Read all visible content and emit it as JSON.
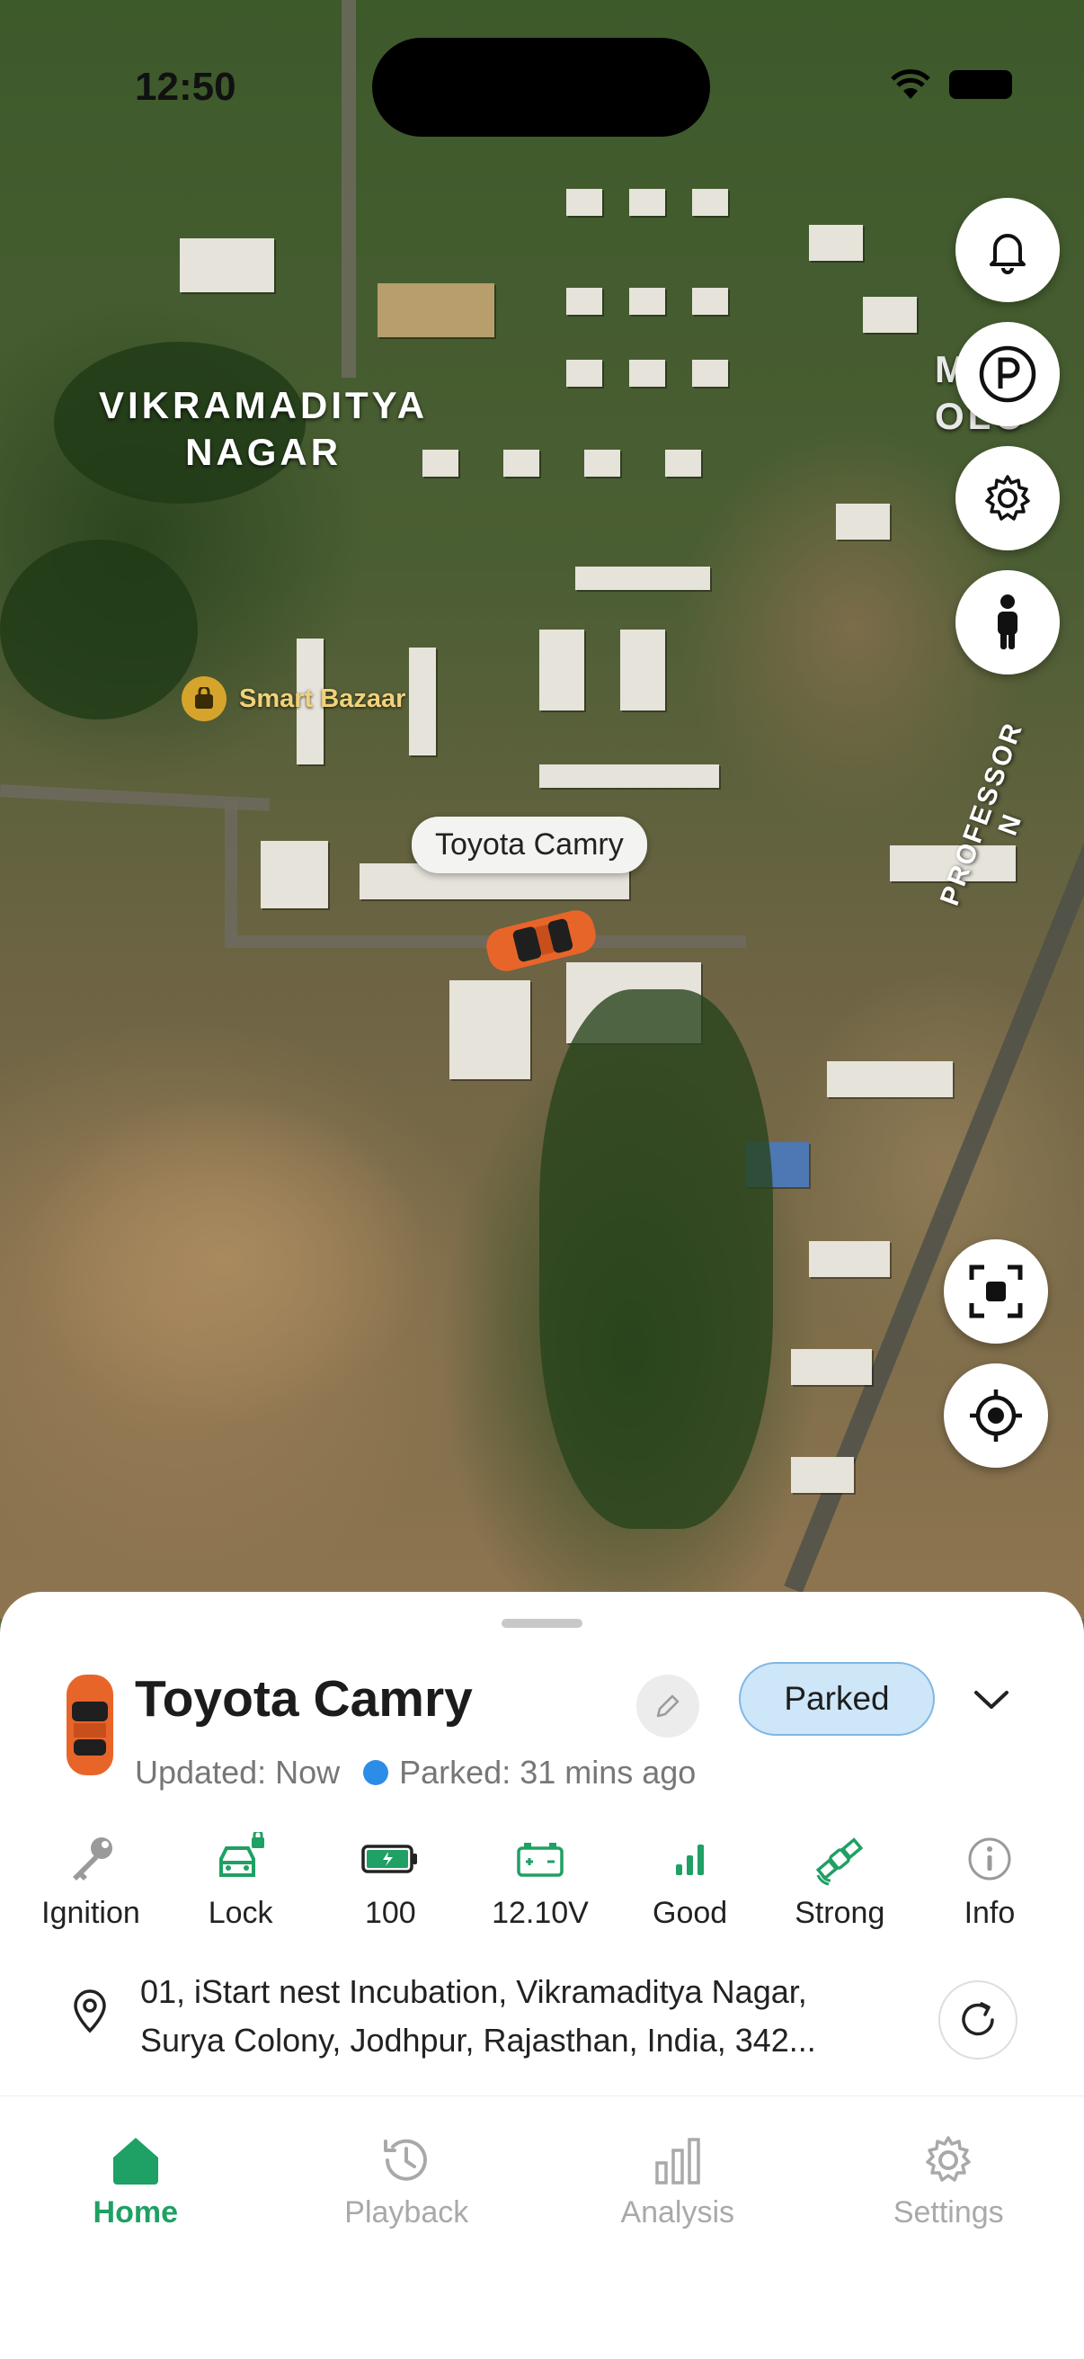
{
  "status_bar": {
    "time": "12:50"
  },
  "map": {
    "area_label": [
      "VIKRAMADITYA",
      "NAGAR"
    ],
    "poi_label": "Smart Bazaar",
    "road_label": "PROFESSOR N",
    "edge_label": [
      "M S",
      "OLO"
    ],
    "car_callout": "Toyota Camry"
  },
  "vehicle": {
    "name": "Toyota Camry",
    "status_badge": "Parked",
    "updated": "Updated: Now",
    "parked_for": "Parked: 31 mins ago"
  },
  "metrics": [
    {
      "icon": "key-icon",
      "label": "Ignition"
    },
    {
      "icon": "lock-icon",
      "label": "Lock"
    },
    {
      "icon": "battery-icon",
      "label": "100"
    },
    {
      "icon": "car-battery-icon",
      "label": "12.10V"
    },
    {
      "icon": "signal-icon",
      "label": "Good"
    },
    {
      "icon": "satellite-icon",
      "label": "Strong"
    },
    {
      "icon": "info-icon",
      "label": "Info"
    }
  ],
  "address": {
    "line1": "01, iStart nest Incubation, Vikramaditya Nagar,",
    "line2": "Surya Colony, Jodhpur, Rajasthan, India, 342..."
  },
  "nav": [
    {
      "label": "Home",
      "active": true
    },
    {
      "label": "Playback",
      "active": false
    },
    {
      "label": "Analysis",
      "active": false
    },
    {
      "label": "Settings",
      "active": false
    }
  ],
  "colors": {
    "accent": "#1fa064",
    "parked_badge_bg": "#cde6f8",
    "parked_dot": "#2b8de8",
    "car": "#e8652a"
  }
}
